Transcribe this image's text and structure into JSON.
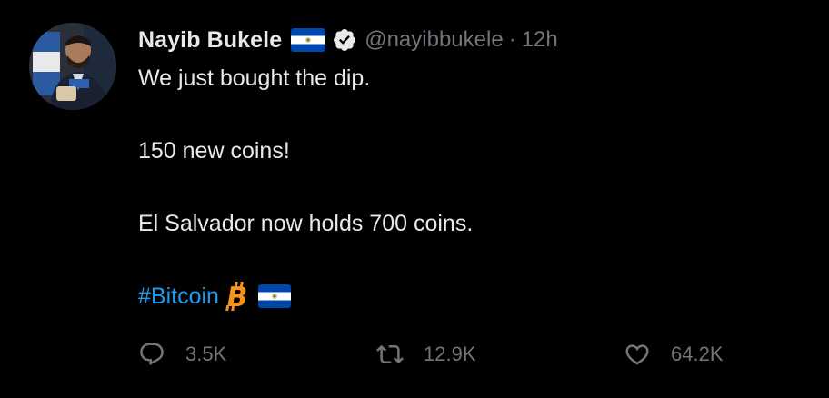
{
  "author": {
    "display_name": "Nayib Bukele",
    "handle": "@nayibbukele",
    "separator": "·",
    "time": "12h",
    "verified": true,
    "flag_icon": "el-salvador-flag-icon",
    "verified_icon": "verified-badge-icon"
  },
  "tweet": {
    "lines": [
      "We just bought the dip.",
      "150 new coins!",
      "El Salvador now holds 700 coins."
    ],
    "hashtag": "#Bitcoin",
    "hashtag_icons": [
      "bitcoin-icon",
      "el-salvador-flag-icon"
    ]
  },
  "actions": {
    "reply": {
      "icon": "reply-icon",
      "count": "3.5K"
    },
    "retweet": {
      "icon": "retweet-icon",
      "count": "12.9K"
    },
    "like": {
      "icon": "like-heart-icon",
      "count": "64.2K"
    }
  },
  "colors": {
    "background": "#000000",
    "text_primary": "#e7e9ea",
    "text_secondary": "#71767b",
    "link": "#1d9bf0",
    "bitcoin_orange": "#f7931a",
    "flag_blue": "#0047ab"
  }
}
